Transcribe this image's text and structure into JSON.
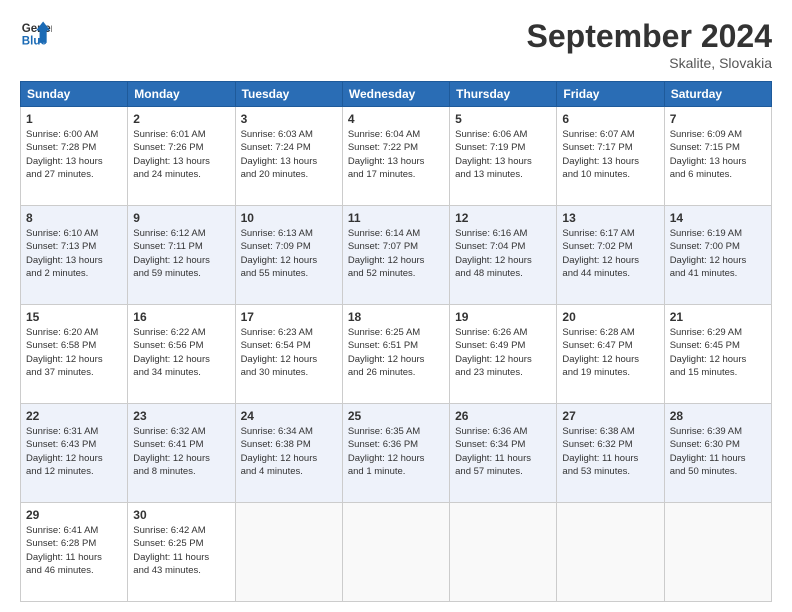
{
  "logo": {
    "line1": "General",
    "line2": "Blue"
  },
  "title": "September 2024",
  "location": "Skalite, Slovakia",
  "days_of_week": [
    "Sunday",
    "Monday",
    "Tuesday",
    "Wednesday",
    "Thursday",
    "Friday",
    "Saturday"
  ],
  "weeks": [
    [
      {
        "day": "1",
        "info": "Sunrise: 6:00 AM\nSunset: 7:28 PM\nDaylight: 13 hours\nand 27 minutes."
      },
      {
        "day": "2",
        "info": "Sunrise: 6:01 AM\nSunset: 7:26 PM\nDaylight: 13 hours\nand 24 minutes."
      },
      {
        "day": "3",
        "info": "Sunrise: 6:03 AM\nSunset: 7:24 PM\nDaylight: 13 hours\nand 20 minutes."
      },
      {
        "day": "4",
        "info": "Sunrise: 6:04 AM\nSunset: 7:22 PM\nDaylight: 13 hours\nand 17 minutes."
      },
      {
        "day": "5",
        "info": "Sunrise: 6:06 AM\nSunset: 7:19 PM\nDaylight: 13 hours\nand 13 minutes."
      },
      {
        "day": "6",
        "info": "Sunrise: 6:07 AM\nSunset: 7:17 PM\nDaylight: 13 hours\nand 10 minutes."
      },
      {
        "day": "7",
        "info": "Sunrise: 6:09 AM\nSunset: 7:15 PM\nDaylight: 13 hours\nand 6 minutes."
      }
    ],
    [
      {
        "day": "8",
        "info": "Sunrise: 6:10 AM\nSunset: 7:13 PM\nDaylight: 13 hours\nand 2 minutes."
      },
      {
        "day": "9",
        "info": "Sunrise: 6:12 AM\nSunset: 7:11 PM\nDaylight: 12 hours\nand 59 minutes."
      },
      {
        "day": "10",
        "info": "Sunrise: 6:13 AM\nSunset: 7:09 PM\nDaylight: 12 hours\nand 55 minutes."
      },
      {
        "day": "11",
        "info": "Sunrise: 6:14 AM\nSunset: 7:07 PM\nDaylight: 12 hours\nand 52 minutes."
      },
      {
        "day": "12",
        "info": "Sunrise: 6:16 AM\nSunset: 7:04 PM\nDaylight: 12 hours\nand 48 minutes."
      },
      {
        "day": "13",
        "info": "Sunrise: 6:17 AM\nSunset: 7:02 PM\nDaylight: 12 hours\nand 44 minutes."
      },
      {
        "day": "14",
        "info": "Sunrise: 6:19 AM\nSunset: 7:00 PM\nDaylight: 12 hours\nand 41 minutes."
      }
    ],
    [
      {
        "day": "15",
        "info": "Sunrise: 6:20 AM\nSunset: 6:58 PM\nDaylight: 12 hours\nand 37 minutes."
      },
      {
        "day": "16",
        "info": "Sunrise: 6:22 AM\nSunset: 6:56 PM\nDaylight: 12 hours\nand 34 minutes."
      },
      {
        "day": "17",
        "info": "Sunrise: 6:23 AM\nSunset: 6:54 PM\nDaylight: 12 hours\nand 30 minutes."
      },
      {
        "day": "18",
        "info": "Sunrise: 6:25 AM\nSunset: 6:51 PM\nDaylight: 12 hours\nand 26 minutes."
      },
      {
        "day": "19",
        "info": "Sunrise: 6:26 AM\nSunset: 6:49 PM\nDaylight: 12 hours\nand 23 minutes."
      },
      {
        "day": "20",
        "info": "Sunrise: 6:28 AM\nSunset: 6:47 PM\nDaylight: 12 hours\nand 19 minutes."
      },
      {
        "day": "21",
        "info": "Sunrise: 6:29 AM\nSunset: 6:45 PM\nDaylight: 12 hours\nand 15 minutes."
      }
    ],
    [
      {
        "day": "22",
        "info": "Sunrise: 6:31 AM\nSunset: 6:43 PM\nDaylight: 12 hours\nand 12 minutes."
      },
      {
        "day": "23",
        "info": "Sunrise: 6:32 AM\nSunset: 6:41 PM\nDaylight: 12 hours\nand 8 minutes."
      },
      {
        "day": "24",
        "info": "Sunrise: 6:34 AM\nSunset: 6:38 PM\nDaylight: 12 hours\nand 4 minutes."
      },
      {
        "day": "25",
        "info": "Sunrise: 6:35 AM\nSunset: 6:36 PM\nDaylight: 12 hours\nand 1 minute."
      },
      {
        "day": "26",
        "info": "Sunrise: 6:36 AM\nSunset: 6:34 PM\nDaylight: 11 hours\nand 57 minutes."
      },
      {
        "day": "27",
        "info": "Sunrise: 6:38 AM\nSunset: 6:32 PM\nDaylight: 11 hours\nand 53 minutes."
      },
      {
        "day": "28",
        "info": "Sunrise: 6:39 AM\nSunset: 6:30 PM\nDaylight: 11 hours\nand 50 minutes."
      }
    ],
    [
      {
        "day": "29",
        "info": "Sunrise: 6:41 AM\nSunset: 6:28 PM\nDaylight: 11 hours\nand 46 minutes."
      },
      {
        "day": "30",
        "info": "Sunrise: 6:42 AM\nSunset: 6:25 PM\nDaylight: 11 hours\nand 43 minutes."
      },
      {
        "day": "",
        "info": ""
      },
      {
        "day": "",
        "info": ""
      },
      {
        "day": "",
        "info": ""
      },
      {
        "day": "",
        "info": ""
      },
      {
        "day": "",
        "info": ""
      }
    ]
  ]
}
